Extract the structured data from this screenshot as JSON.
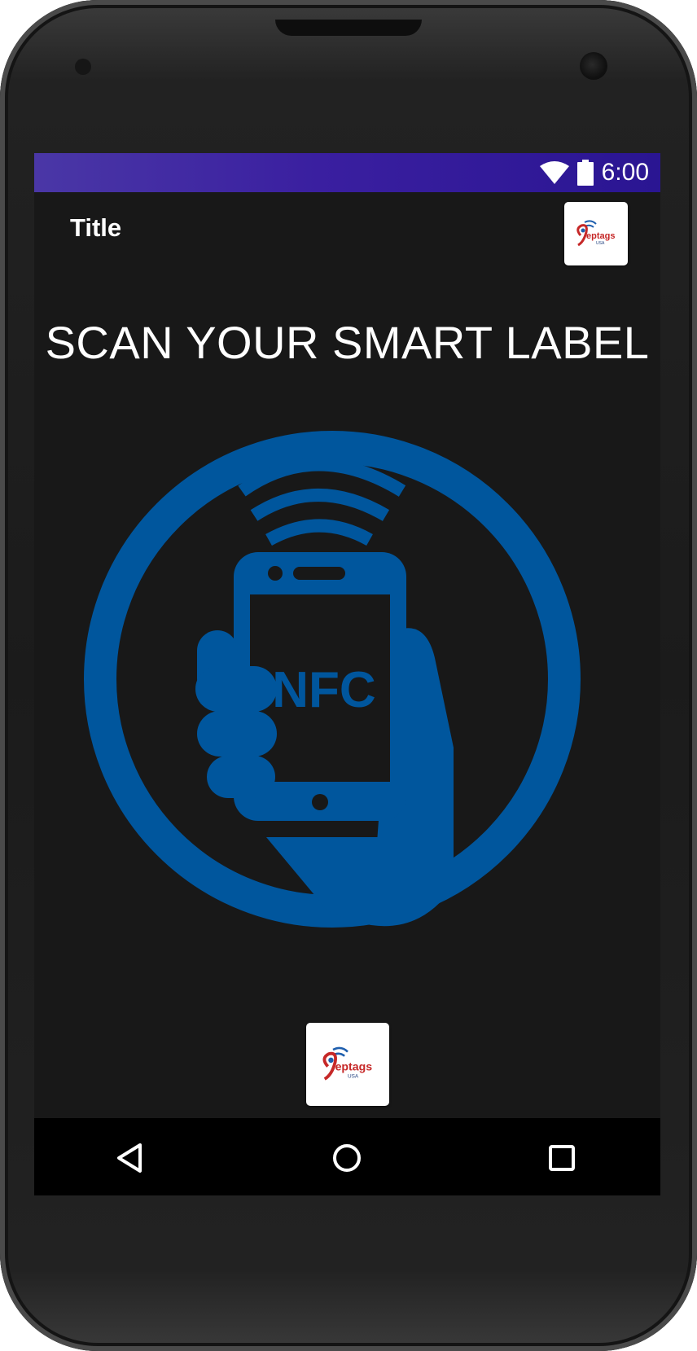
{
  "status_bar": {
    "time": "6:00",
    "icons": [
      "wifi-icon",
      "battery-icon"
    ]
  },
  "toolbar": {
    "title": "Title",
    "logo_text": "eptags",
    "logo_subtext": "USA"
  },
  "main": {
    "headline": "SCAN YOUR SMART LABEL",
    "graphic": {
      "icon": "nfc-phone-icon",
      "label": "NFC",
      "color": "#00569d"
    },
    "bottom_logo": {
      "logo_text": "eptags",
      "logo_subtext": "USA"
    }
  },
  "nav_bar": {
    "icons": [
      "back-icon",
      "home-icon",
      "recents-icon"
    ]
  },
  "colors": {
    "status_bar": "#3a1fa0",
    "screen_bg": "#181818",
    "accent_blue": "#00569d"
  }
}
